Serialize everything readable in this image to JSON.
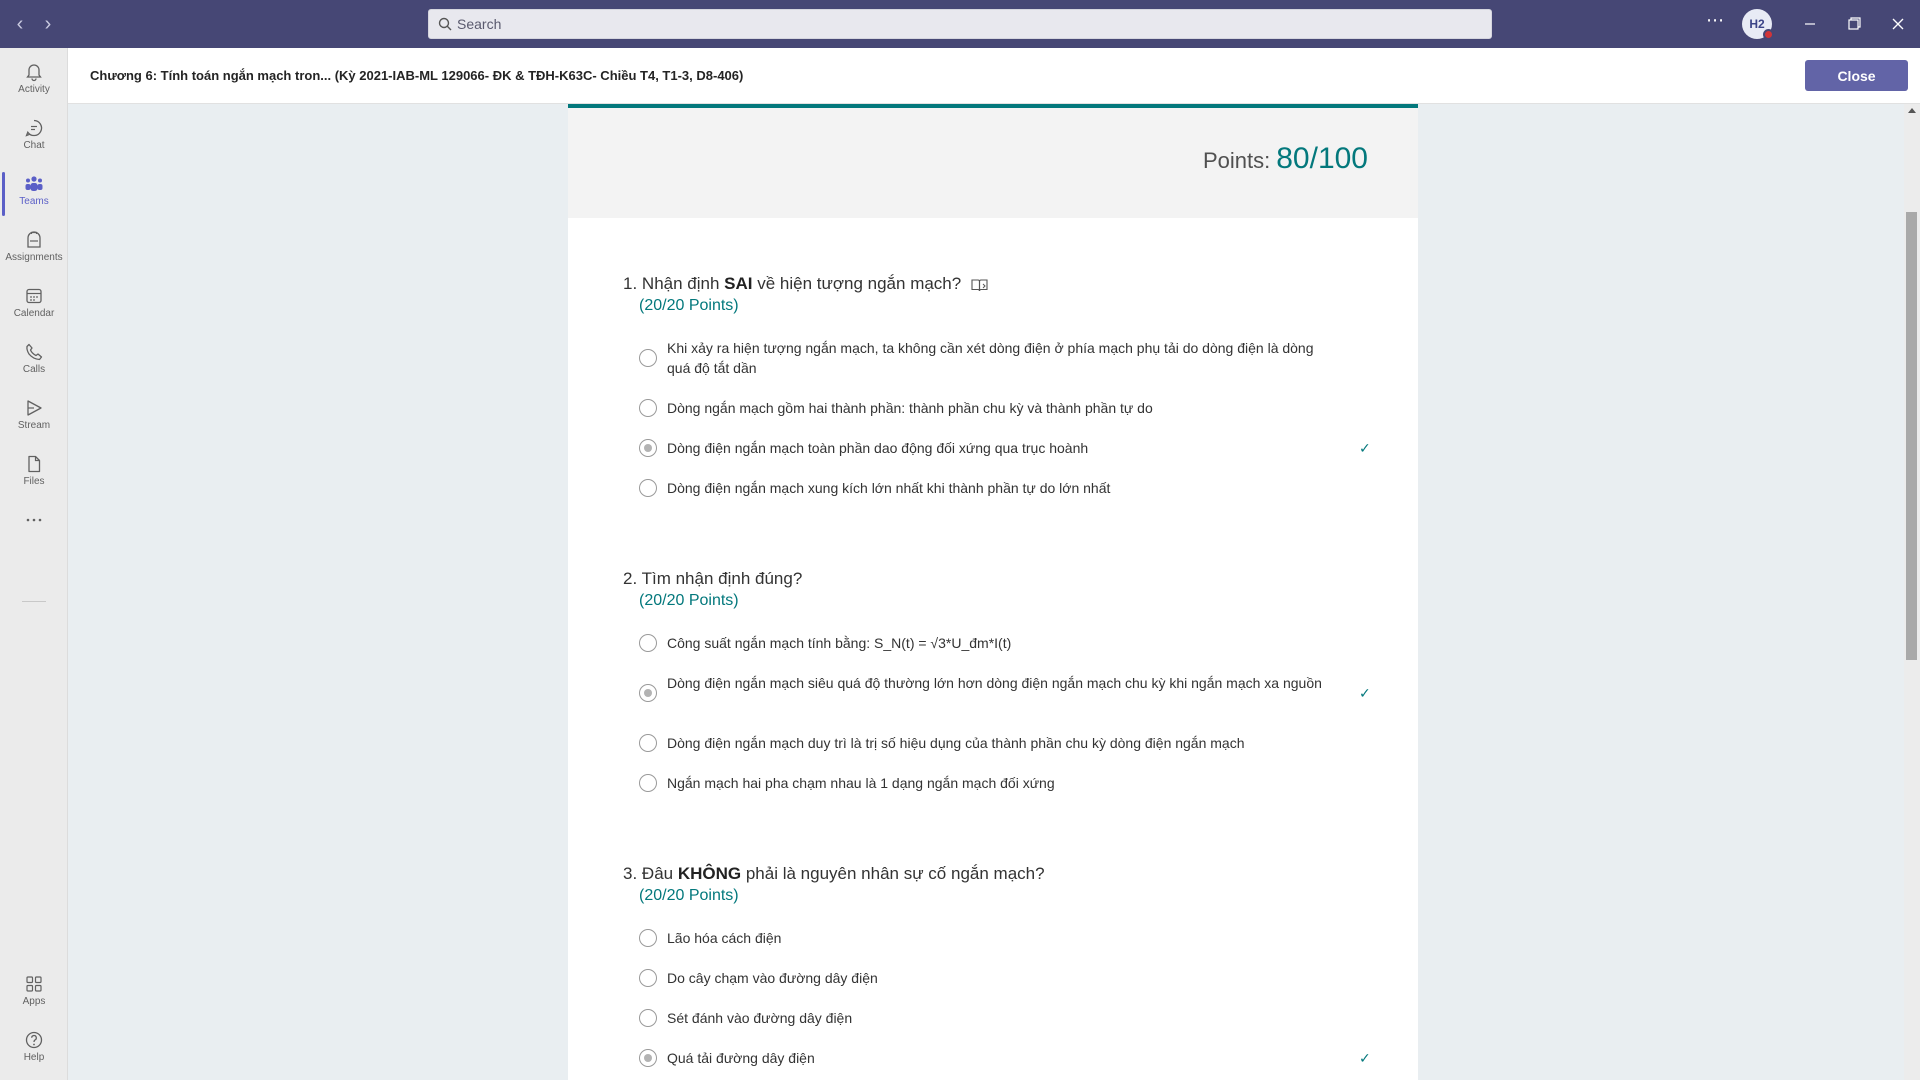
{
  "search": {
    "placeholder": "Search"
  },
  "user": {
    "initials": "H2"
  },
  "rail": [
    {
      "label": "Activity"
    },
    {
      "label": "Chat"
    },
    {
      "label": "Teams"
    },
    {
      "label": "Assignments"
    },
    {
      "label": "Calendar"
    },
    {
      "label": "Calls"
    },
    {
      "label": "Stream"
    },
    {
      "label": "Files"
    },
    {
      "label": "Apps"
    },
    {
      "label": "Help"
    }
  ],
  "header": {
    "title": "Chương 6: Tính toán ngắn mạch tron... (Kỳ 2021-IAB-ML 129066- ĐK & TĐH-K63C- Chiều T4, T1-3, D8-406)",
    "close_label": "Close"
  },
  "quiz": {
    "points_label": "Points:",
    "points_value": "80/100",
    "questions": [
      {
        "num": "1.",
        "pre": "Nhận định ",
        "bold": "SAI",
        "post": " về hiện tượng ngắn mạch?",
        "points": "(20/20 Points)",
        "options": [
          "Khi xảy ra hiện tượng ngắn mạch, ta không cần xét dòng điện ở phía mạch phụ tải do dòng điện là dòng quá độ tắt dần",
          "Dòng ngắn mạch gồm hai thành phần: thành phần chu kỳ và thành phần tự do",
          "Dòng điện ngắn mạch toàn phần dao động đối xứng qua trục hoành",
          "Dòng điện ngắn mạch xung kích lớn nhất khi thành phần tự do lớn nhất"
        ]
      },
      {
        "num": "2.",
        "pre": "Tìm nhận định đúng?",
        "bold": "",
        "post": "",
        "points": "(20/20 Points)",
        "options": [
          "Công suất ngắn mạch tính bằng: S_N(t) = √3*U_đm*I(t)",
          "Dòng điện ngắn mạch siêu quá độ thường lớn hơn dòng điện ngắn mạch chu kỳ khi ngắn mạch xa nguồn",
          "Dòng điện ngắn mạch duy trì là trị số hiệu dụng của thành phần chu kỳ dòng điện ngắn mạch",
          "Ngắn mạch hai pha chạm nhau là 1 dạng ngắn mạch đối xứng"
        ]
      },
      {
        "num": "3.",
        "pre": "Đâu ",
        "bold": "KHÔNG",
        "post": " phải là nguyên nhân sự cố ngắn mạch?",
        "points": "(20/20 Points)",
        "options": [
          "Lão hóa cách điện",
          "Do cây chạm vào đường dây điện",
          "Sét đánh vào đường dây điện",
          "Quá tải đường dây điện"
        ]
      }
    ]
  }
}
